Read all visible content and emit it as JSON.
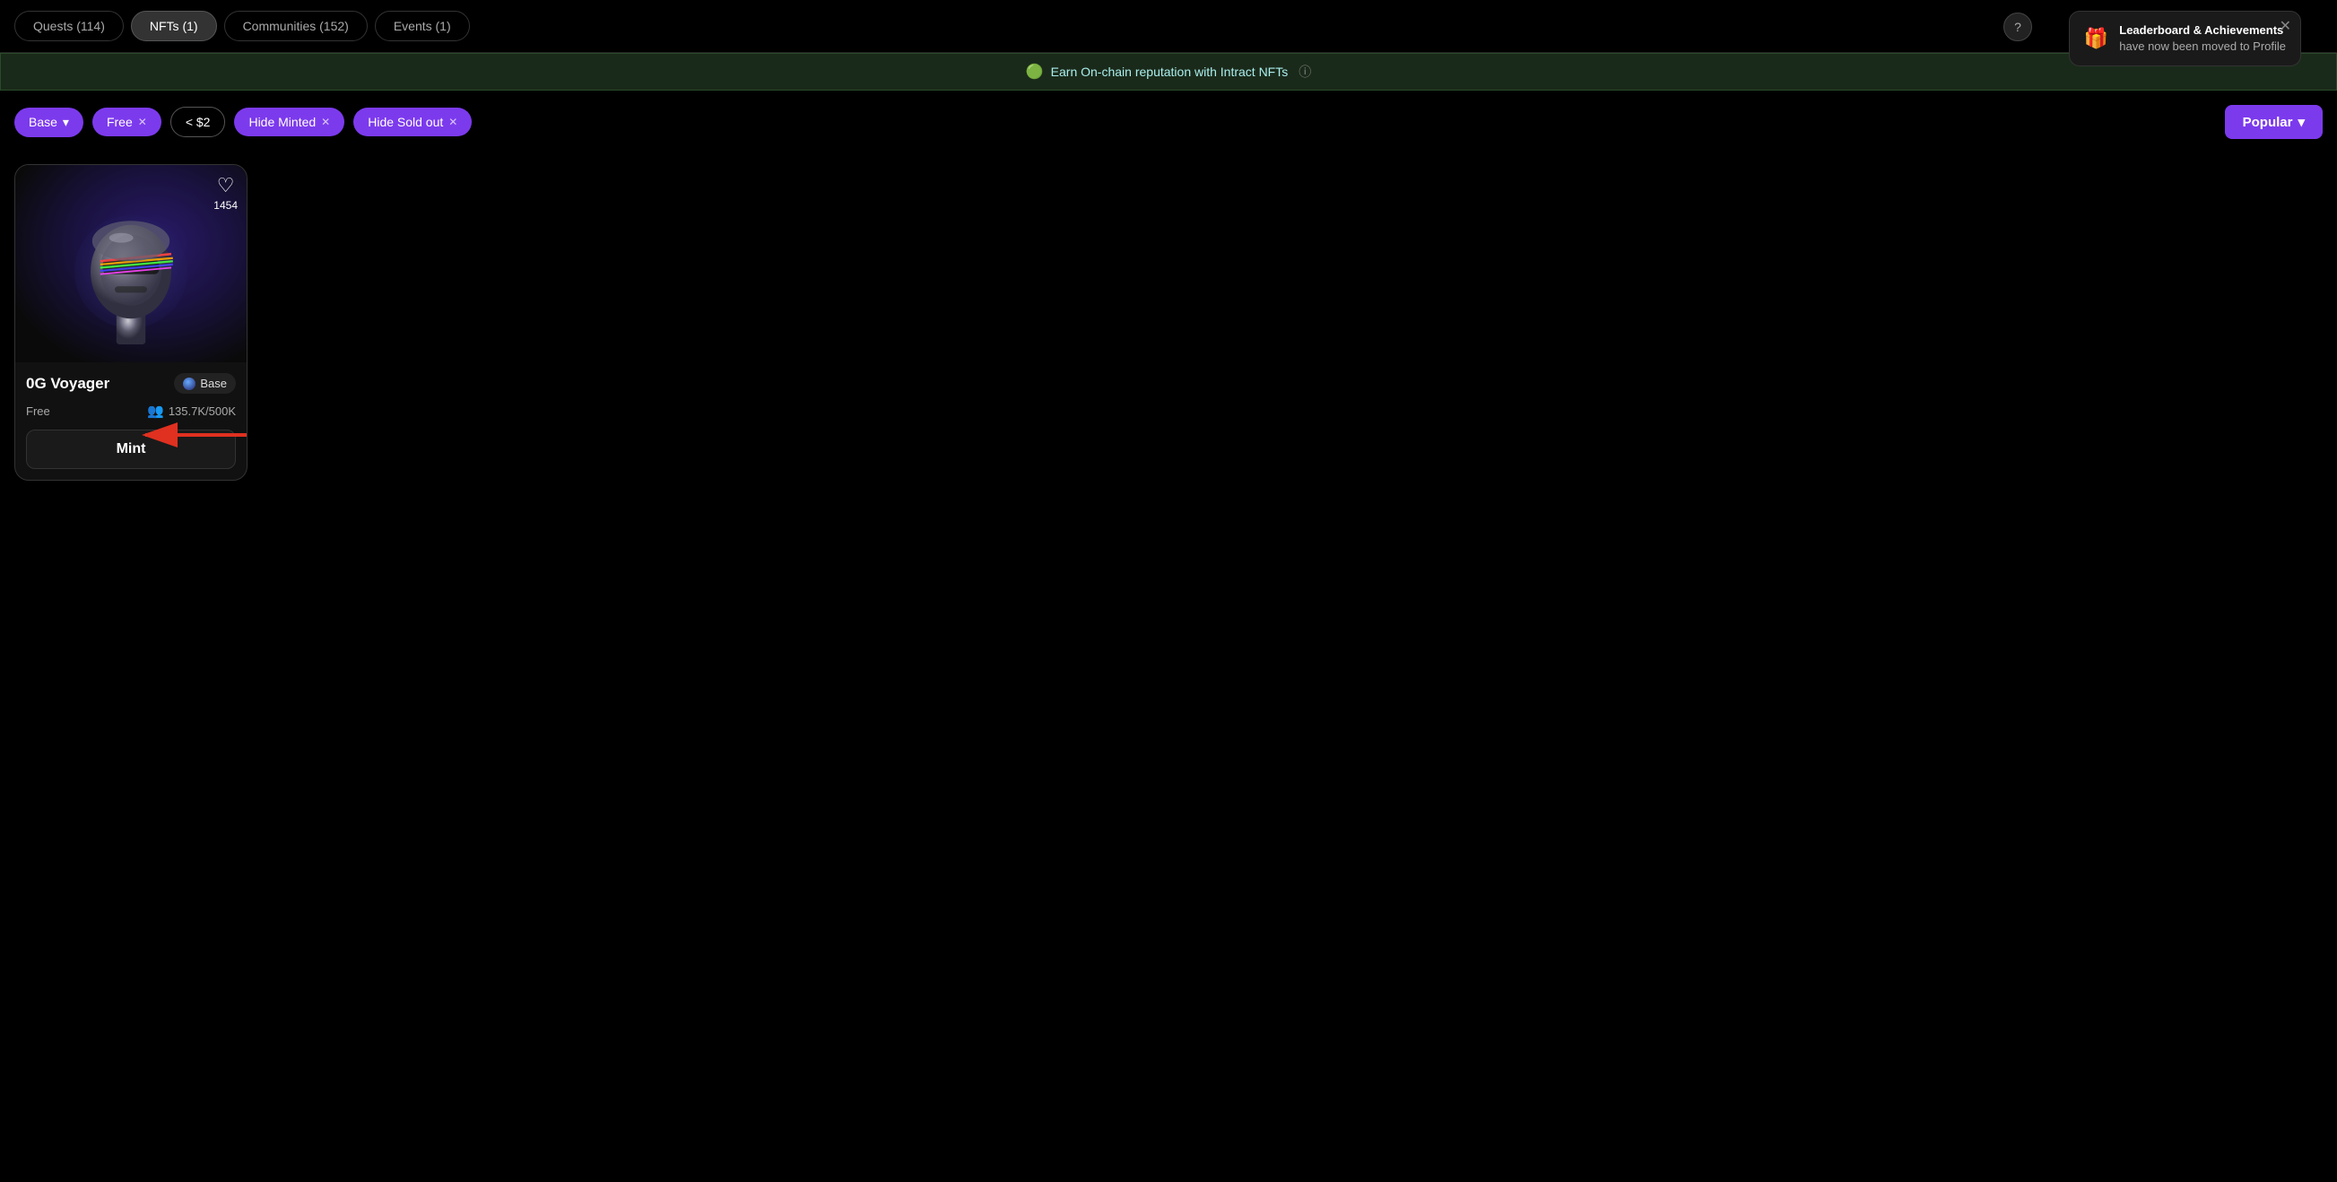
{
  "tabs": [
    {
      "id": "quests",
      "label": "Quests (114)",
      "active": false
    },
    {
      "id": "nfts",
      "label": "NFTs (1)",
      "active": true
    },
    {
      "id": "communities",
      "label": "Communities (152)",
      "active": false
    },
    {
      "id": "events",
      "label": "Events (1)",
      "active": false
    }
  ],
  "banner": {
    "icon": "🟢",
    "text": "Earn On-chain reputation with Intract NFTs",
    "info_icon": "ⓘ"
  },
  "filters": [
    {
      "id": "base",
      "label": "Base",
      "type": "dropdown",
      "style": "purple"
    },
    {
      "id": "free",
      "label": "Free",
      "type": "removable",
      "style": "purple"
    },
    {
      "id": "price",
      "label": "< $2",
      "type": "plain",
      "style": "outline"
    },
    {
      "id": "hide-minted",
      "label": "Hide Minted",
      "type": "removable",
      "style": "purple"
    },
    {
      "id": "hide-soldout",
      "label": "Hide Sold out",
      "type": "removable",
      "style": "purple"
    }
  ],
  "sort": {
    "label": "Popular",
    "arrow": "▾"
  },
  "nft_card": {
    "image_alt": "0G Voyager NFT - metallic robot head with rainbow visor",
    "heart_count": "1454",
    "name": "0G Voyager",
    "chain": "Base",
    "price": "Free",
    "mint_count": "135.7K/500K",
    "mint_button": "Mint"
  },
  "notification": {
    "icon": "🎁",
    "title": "Leaderboard & Achievements",
    "subtitle": "have now been moved to Profile"
  },
  "icons": {
    "question": "?",
    "close": "✕",
    "heart": "♡",
    "people": "👥",
    "chevron_down": "▾",
    "remove": "✕"
  }
}
